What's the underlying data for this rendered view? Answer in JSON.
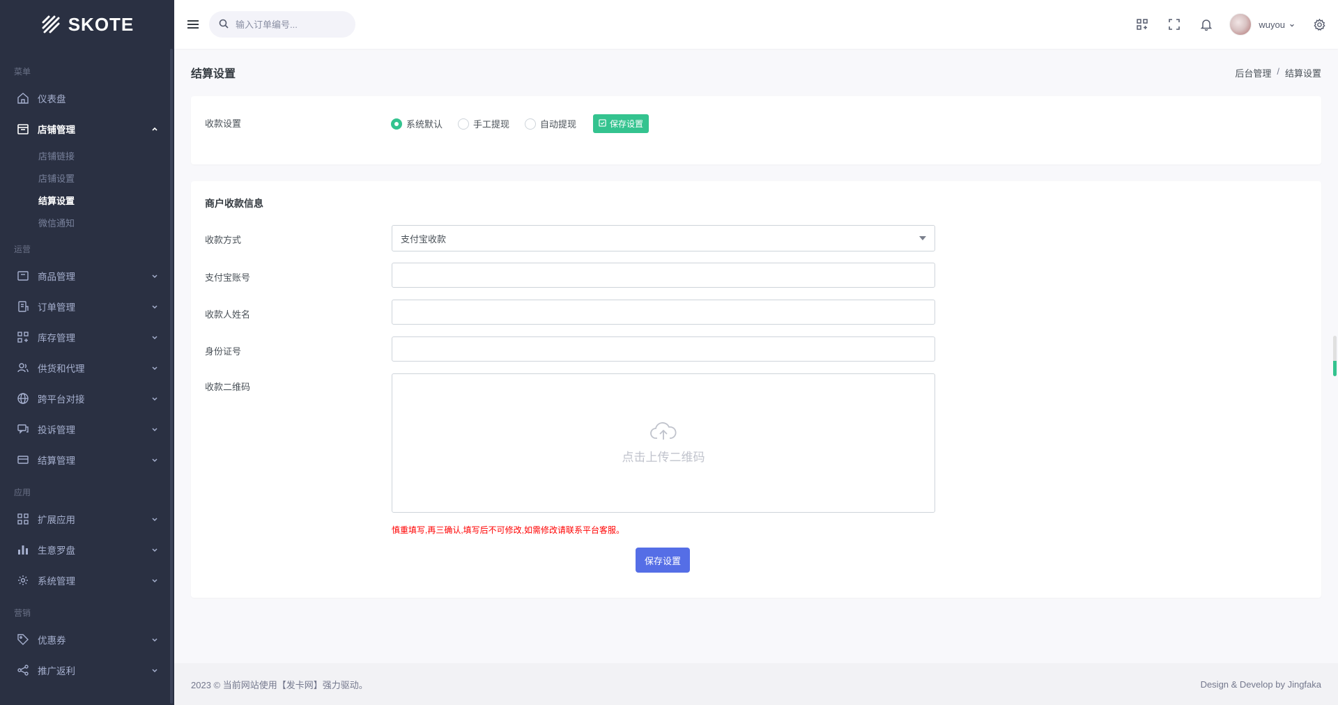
{
  "brand": {
    "name": "SKOTE"
  },
  "sidebar": {
    "sections": {
      "menu": "菜单",
      "ops": "运营",
      "apps": "应用",
      "marketing": "营销"
    },
    "dashboard": "仪表盘",
    "store": {
      "label": "店铺管理",
      "children": [
        "店铺链接",
        "店铺设置",
        "结算设置",
        "微信通知"
      ]
    },
    "ops_items": [
      "商品管理",
      "订单管理",
      "库存管理",
      "供货和代理",
      "跨平台对接",
      "投诉管理",
      "结算管理"
    ],
    "app_items": [
      "扩展应用",
      "生意罗盘",
      "系统管理"
    ],
    "marketing_items": [
      "优惠券",
      "推广返利"
    ]
  },
  "topbar": {
    "search_placeholder": "输入订单编号...",
    "user_name": "wuyou"
  },
  "page": {
    "title": "结算设置",
    "breadcrumb": [
      "后台管理",
      "结算设置"
    ]
  },
  "payout_settings": {
    "label": "收款设置",
    "options": [
      "系统默认",
      "手工提现",
      "自动提现"
    ],
    "selected": "系统默认",
    "save_label": "保存设置"
  },
  "merchant_info": {
    "title": "商户收款信息",
    "method_label": "收款方式",
    "method_value": "支付宝收款",
    "account_label": "支付宝账号",
    "account_value": "",
    "name_label": "收款人姓名",
    "name_value": "",
    "id_label": "身份证号",
    "id_value": "",
    "qr_label": "收款二维码",
    "qr_upload_text": "点击上传二维码",
    "warning": "慎重填写,再三确认,填写后不可修改,如需修改请联系平台客服。",
    "save_label": "保存设置"
  },
  "footer": {
    "left": "2023 © 当前网站使用【发卡网】强力驱动。",
    "right": "Design & Develop by Jingfaka"
  },
  "colors": {
    "sidebar_bg": "#2a3042",
    "accent_green": "#34c38f",
    "accent_blue": "#556ee6",
    "warning_red": "#ff0000"
  }
}
